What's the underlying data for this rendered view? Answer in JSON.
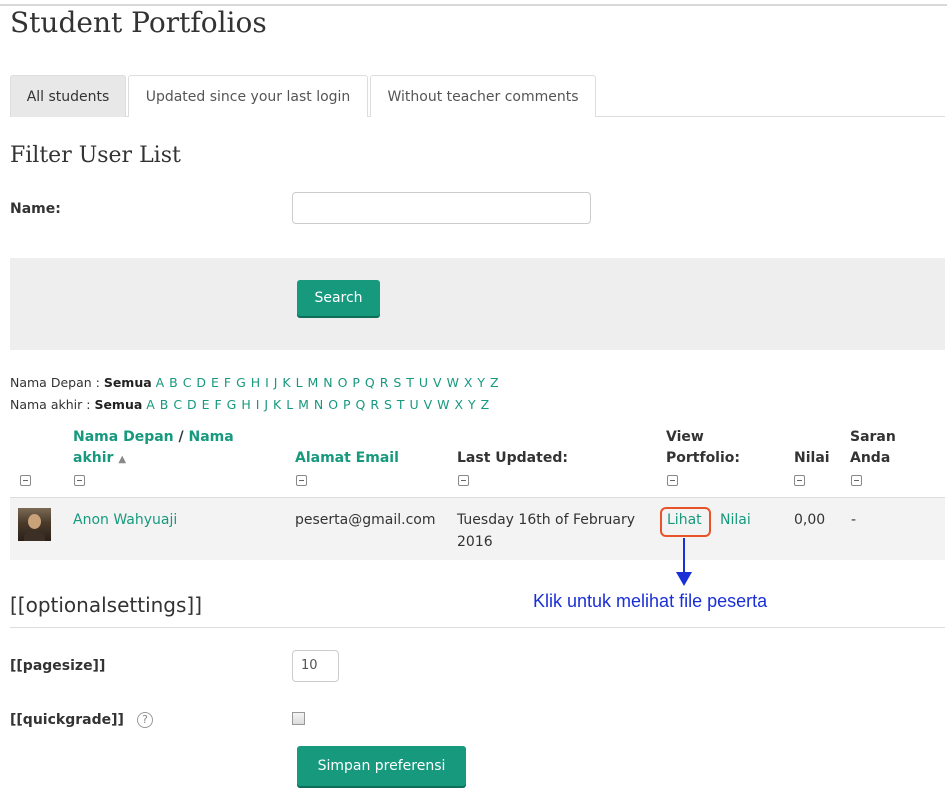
{
  "page": {
    "title": "Student Portfolios"
  },
  "tabs": [
    {
      "label": "All students",
      "active": true
    },
    {
      "label": "Updated since your last login",
      "active": false
    },
    {
      "label": "Without teacher comments",
      "active": false
    }
  ],
  "filter": {
    "heading": "Filter User List",
    "name_label": "Name:",
    "name_value": "",
    "search_label": "Search"
  },
  "initials": {
    "first": {
      "label": "Nama Depan :",
      "all": "Semua",
      "letters": "A B C D E F G H I J K L M N O P Q R S T U V W X Y Z"
    },
    "last": {
      "label": "Nama akhir :",
      "all": "Semua",
      "letters": "A B C D E F G H I J K L M N O P Q R S T U V W X Y Z"
    }
  },
  "table": {
    "headers": {
      "name_first": "Nama Depan",
      "name_sep": " / ",
      "name_last": "Nama",
      "name_last2": "akhir",
      "sort_icon": "▲",
      "email": "Alamat Email",
      "last_updated": "Last Updated:",
      "view_portfolio_1": "View",
      "view_portfolio_2": "Portfolio:",
      "nilai": "Nilai",
      "saran_1": "Saran",
      "saran_2": "Anda"
    },
    "rows": [
      {
        "name": "Anon Wahyuaji",
        "email": "peserta@gmail.com",
        "updated_1": "Tuesday 16th of February",
        "updated_2": "2016",
        "view_link": "Lihat",
        "grade_link": "Nilai",
        "grade": "0,00",
        "feedback": "-"
      }
    ]
  },
  "annotation": {
    "text": "Klik untuk melihat file peserta",
    "color": "#1a2fd6",
    "highlight_color": "#e8542a"
  },
  "options": {
    "title": "[[optionalsettings]]",
    "pagesize_label": "[[pagesize]]",
    "pagesize_value": "10",
    "quickgrade_label": "[[quickgrade]]",
    "quickgrade_checked": false,
    "help_icon": "?",
    "save_label": "Simpan preferensi"
  },
  "colors": {
    "accent": "#17997e"
  }
}
